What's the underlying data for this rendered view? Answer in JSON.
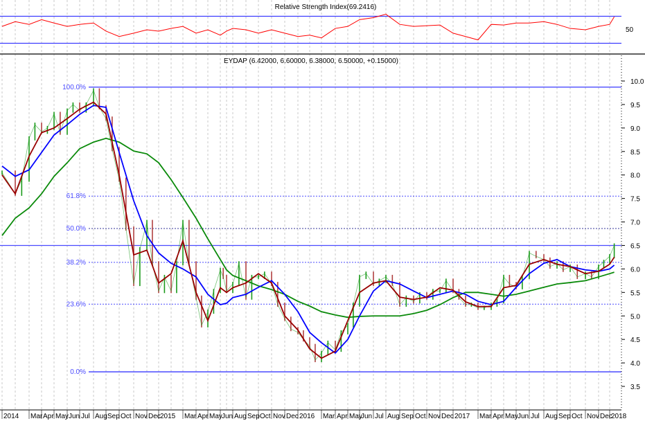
{
  "chart_data": [
    {
      "type": "line",
      "panel": "rsi",
      "title": "Relative Strength Index(69.2416)",
      "y_tick_labels": [
        "50"
      ],
      "guide_levels": [
        70,
        30
      ],
      "ylim": [
        10,
        90
      ],
      "colors": {
        "rsi": "#ff0000",
        "guides": "#3b3bff"
      },
      "series": [
        {
          "x": [
            "2014-01-01",
            "2014-02-01",
            "2014-03-01",
            "2014-04-01",
            "2014-05-01",
            "2014-06-01",
            "2014-07-01",
            "2014-08-01",
            "2014-09-01",
            "2014-10-01",
            "2014-11-01",
            "2014-12-01",
            "2015-01-01",
            "2015-02-01",
            "2015-03-01",
            "2015-04-01",
            "2015-05-01",
            "2015-06-01",
            "2015-07-01",
            "2015-08-01",
            "2015-09-01",
            "2015-10-01",
            "2015-11-01",
            "2015-12-01",
            "2016-01-01",
            "2016-02-01",
            "2016-03-01",
            "2016-04-01",
            "2016-05-01",
            "2016-06-01",
            "2016-07-01",
            "2016-08-01",
            "2016-09-01",
            "2016-10-01",
            "2016-11-01",
            "2016-12-01",
            "2017-01-01",
            "2017-02-01",
            "2017-03-01",
            "2017-04-01",
            "2017-05-01",
            "2017-06-01",
            "2017-07-01",
            "2017-08-01",
            "2017-09-01",
            "2017-10-01",
            "2017-11-01",
            "2017-12-01",
            "2018-01-01",
            "2018-01-12"
          ],
          "values": [
            55,
            62,
            58,
            65,
            60,
            55,
            58,
            60,
            48,
            40,
            45,
            50,
            48,
            52,
            55,
            45,
            50,
            42,
            48,
            52,
            50,
            45,
            50,
            45,
            40,
            42,
            38,
            52,
            55,
            65,
            68,
            73,
            58,
            55,
            56,
            57,
            45,
            40,
            35,
            58,
            57,
            60,
            60,
            62,
            58,
            52,
            50,
            55,
            58,
            69.24
          ]
        }
      ]
    },
    {
      "type": "bar",
      "panel": "price",
      "title": "EYDAP (6.42000, 6.60000, 6.38000, 6.50000, +0.15000)",
      "ylim": [
        3.3,
        10.4
      ],
      "y_tick_labels": [
        "3.5",
        "4.0",
        "4.5",
        "5.0",
        "5.5",
        "6.0",
        "6.5",
        "7.0",
        "7.5",
        "8.0",
        "8.5",
        "9.0",
        "9.5",
        "10.0"
      ],
      "x_tick_labels": [
        {
          "label": "2014",
          "date": "2014-01-01"
        },
        {
          "label": "Mar",
          "date": "2014-03-01"
        },
        {
          "label": "Apr",
          "date": "2014-04-01"
        },
        {
          "label": "May",
          "date": "2014-05-01"
        },
        {
          "label": "Jun",
          "date": "2014-06-01"
        },
        {
          "label": "Jul",
          "date": "2014-07-01"
        },
        {
          "label": "Aug",
          "date": "2014-08-01"
        },
        {
          "label": "Sep",
          "date": "2014-09-01"
        },
        {
          "label": "Oct",
          "date": "2014-10-01"
        },
        {
          "label": "Nov",
          "date": "2014-11-01"
        },
        {
          "label": "Dec",
          "date": "2014-12-01"
        },
        {
          "label": "2015",
          "date": "2015-01-01"
        },
        {
          "label": "Mar",
          "date": "2015-03-01"
        },
        {
          "label": "Apr",
          "date": "2015-04-01"
        },
        {
          "label": "May",
          "date": "2015-05-01"
        },
        {
          "label": "Jun",
          "date": "2015-06-01"
        },
        {
          "label": "Aug",
          "date": "2015-08-01"
        },
        {
          "label": "Sep",
          "date": "2015-09-01"
        },
        {
          "label": "Oct",
          "date": "2015-10-01"
        },
        {
          "label": "Nov",
          "date": "2015-11-01"
        },
        {
          "label": "Dec",
          "date": "2015-12-01"
        },
        {
          "label": "2016",
          "date": "2016-01-01"
        },
        {
          "label": "Mar",
          "date": "2016-03-01"
        },
        {
          "label": "Apr",
          "date": "2016-04-01"
        },
        {
          "label": "May",
          "date": "2016-05-01"
        },
        {
          "label": "Jun",
          "date": "2016-06-01"
        },
        {
          "label": "Jul",
          "date": "2016-07-01"
        },
        {
          "label": "Aug",
          "date": "2016-08-01"
        },
        {
          "label": "Sep",
          "date": "2016-09-01"
        },
        {
          "label": "Oct",
          "date": "2016-10-01"
        },
        {
          "label": "Nov",
          "date": "2016-11-01"
        },
        {
          "label": "Dec",
          "date": "2016-12-01"
        },
        {
          "label": "2017",
          "date": "2017-01-01"
        },
        {
          "label": "Mar",
          "date": "2017-03-01"
        },
        {
          "label": "Apr",
          "date": "2017-04-01"
        },
        {
          "label": "May",
          "date": "2017-05-01"
        },
        {
          "label": "Jun",
          "date": "2017-06-01"
        },
        {
          "label": "Jul",
          "date": "2017-07-01"
        },
        {
          "label": "Aug",
          "date": "2017-08-01"
        },
        {
          "label": "Sep",
          "date": "2017-09-01"
        },
        {
          "label": "Oct",
          "date": "2017-10-01"
        },
        {
          "label": "Nov",
          "date": "2017-11-01"
        },
        {
          "label": "Dec",
          "date": "2017-12-01"
        },
        {
          "label": "2018",
          "date": "2018-01-01"
        }
      ],
      "fibonacci_levels": [
        {
          "label": "100.0%",
          "price": 9.87,
          "style": "solid"
        },
        {
          "label": "61.8%",
          "price": 7.55,
          "style": "dotted"
        },
        {
          "label": "50.0%",
          "price": 6.86,
          "style": "dotted"
        },
        {
          "label": "38.2%",
          "price": 6.14,
          "style": "dotted"
        },
        {
          "label": "23.6%",
          "price": 5.25,
          "style": "dotted"
        },
        {
          "label": "0.0%",
          "price": 3.81,
          "style": "solid"
        }
      ],
      "horizontal_line": 6.5,
      "grid": "vertical dashed",
      "colors": {
        "up": "#1a9a1a",
        "down": "#b04040",
        "ma_short": "#990000",
        "ma_mid": "#0000ff",
        "ma_long": "#0a8a0a",
        "fib": "#4a4aff",
        "fib_mid": "#333399"
      },
      "close": [
        [
          "2014-01-01",
          8.05
        ],
        [
          "2014-02-01",
          7.6
        ],
        [
          "2014-02-15",
          7.9
        ],
        [
          "2014-03-01",
          8.78
        ],
        [
          "2014-03-15",
          9.07
        ],
        [
          "2014-04-01",
          8.92
        ],
        [
          "2014-04-15",
          9.0
        ],
        [
          "2014-05-01",
          9.3
        ],
        [
          "2014-05-15",
          8.9
        ],
        [
          "2014-06-01",
          9.37
        ],
        [
          "2014-06-15",
          9.5
        ],
        [
          "2014-07-01",
          9.37
        ],
        [
          "2014-07-15",
          9.5
        ],
        [
          "2014-08-01",
          9.8
        ],
        [
          "2014-08-15",
          9.44
        ],
        [
          "2014-09-01",
          9.2
        ],
        [
          "2014-09-15",
          8.55
        ],
        [
          "2014-10-01",
          7.9
        ],
        [
          "2014-10-15",
          6.86
        ],
        [
          "2014-11-01",
          5.68
        ],
        [
          "2014-11-15",
          6.42
        ],
        [
          "2014-12-01",
          7.0
        ],
        [
          "2014-12-15",
          6.12
        ],
        [
          "2015-01-01",
          5.53
        ],
        [
          "2015-01-15",
          5.83
        ],
        [
          "2015-02-01",
          5.53
        ],
        [
          "2015-02-15",
          6.12
        ],
        [
          "2015-03-01",
          7.0
        ],
        [
          "2015-03-15",
          6.12
        ],
        [
          "2015-04-01",
          5.39
        ],
        [
          "2015-04-15",
          4.8
        ],
        [
          "2015-05-01",
          5.09
        ],
        [
          "2015-05-15",
          5.53
        ],
        [
          "2015-06-01",
          5.98
        ],
        [
          "2015-06-15",
          5.83
        ],
        [
          "2015-07-01",
          5.53
        ],
        [
          "2015-08-01",
          5.68
        ],
        [
          "2015-08-15",
          6.12
        ],
        [
          "2015-09-01",
          5.39
        ],
        [
          "2015-09-15",
          5.83
        ],
        [
          "2015-10-01",
          5.83
        ],
        [
          "2015-10-15",
          5.9
        ],
        [
          "2015-11-01",
          5.68
        ],
        [
          "2015-11-15",
          5.24
        ],
        [
          "2015-12-01",
          4.94
        ],
        [
          "2015-12-15",
          4.72
        ],
        [
          "2016-01-01",
          4.65
        ],
        [
          "2016-01-15",
          4.5
        ],
        [
          "2016-02-01",
          4.36
        ],
        [
          "2016-02-15",
          4.06
        ],
        [
          "2016-03-01",
          4.21
        ],
        [
          "2016-03-15",
          4.43
        ],
        [
          "2016-04-01",
          4.28
        ],
        [
          "2016-04-15",
          4.65
        ],
        [
          "2016-05-01",
          4.8
        ],
        [
          "2016-05-15",
          5.24
        ],
        [
          "2016-06-01",
          5.83
        ],
        [
          "2016-06-15",
          5.9
        ],
        [
          "2016-07-01",
          5.68
        ],
        [
          "2016-07-15",
          5.75
        ],
        [
          "2016-08-01",
          5.83
        ],
        [
          "2016-08-15",
          5.68
        ],
        [
          "2016-09-01",
          5.24
        ],
        [
          "2016-09-15",
          5.39
        ],
        [
          "2016-10-01",
          5.31
        ],
        [
          "2016-10-15",
          5.46
        ],
        [
          "2016-11-01",
          5.39
        ],
        [
          "2016-11-15",
          5.53
        ],
        [
          "2016-12-01",
          5.53
        ],
        [
          "2016-12-15",
          5.75
        ],
        [
          "2017-01-01",
          5.53
        ],
        [
          "2017-01-15",
          5.39
        ],
        [
          "2017-02-01",
          5.24
        ],
        [
          "2017-02-15",
          5.24
        ],
        [
          "2017-03-01",
          5.17
        ],
        [
          "2017-03-15",
          5.17
        ],
        [
          "2017-04-01",
          5.24
        ],
        [
          "2017-04-15",
          5.31
        ],
        [
          "2017-05-01",
          5.83
        ],
        [
          "2017-05-15",
          5.68
        ],
        [
          "2017-06-01",
          5.61
        ],
        [
          "2017-06-15",
          5.83
        ],
        [
          "2017-07-01",
          6.34
        ],
        [
          "2017-07-15",
          6.27
        ],
        [
          "2017-08-01",
          6.2
        ],
        [
          "2017-08-15",
          6.05
        ],
        [
          "2017-09-01",
          6.12
        ],
        [
          "2017-09-15",
          5.98
        ],
        [
          "2017-10-01",
          6.05
        ],
        [
          "2017-10-15",
          5.83
        ],
        [
          "2017-11-01",
          5.9
        ],
        [
          "2017-11-15",
          5.83
        ],
        [
          "2017-12-01",
          6.05
        ],
        [
          "2017-12-15",
          6.15
        ],
        [
          "2018-01-01",
          6.27
        ],
        [
          "2018-01-12",
          6.5
        ]
      ],
      "moving_averages": {
        "dates": [
          "2014-01-01",
          "2014-02-01",
          "2014-03-01",
          "2014-04-01",
          "2014-05-01",
          "2014-06-01",
          "2014-07-01",
          "2014-08-01",
          "2014-09-01",
          "2014-10-01",
          "2014-11-01",
          "2014-12-01",
          "2015-01-01",
          "2015-02-01",
          "2015-03-01",
          "2015-04-01",
          "2015-05-01",
          "2015-06-01",
          "2015-07-01",
          "2015-08-01",
          "2015-09-01",
          "2015-10-01",
          "2015-11-01",
          "2015-12-01",
          "2016-01-01",
          "2016-02-01",
          "2016-03-01",
          "2016-04-01",
          "2016-05-01",
          "2016-06-01",
          "2016-07-01",
          "2016-08-01",
          "2016-09-01",
          "2016-10-01",
          "2016-11-01",
          "2016-12-01",
          "2017-01-01",
          "2017-02-01",
          "2017-03-01",
          "2017-04-01",
          "2017-05-01",
          "2017-06-01",
          "2017-07-01",
          "2017-08-01",
          "2017-09-01",
          "2017-10-01",
          "2017-11-01",
          "2017-12-01",
          "2018-01-01",
          "2018-01-12"
        ],
        "short": [
          8.0,
          7.6,
          8.4,
          8.9,
          9.0,
          9.2,
          9.4,
          9.55,
          9.3,
          8.0,
          6.3,
          6.4,
          5.7,
          5.9,
          6.6,
          5.5,
          4.9,
          5.6,
          5.5,
          5.6,
          5.7,
          5.9,
          5.7,
          5.0,
          4.7,
          4.3,
          4.1,
          4.25,
          4.9,
          5.5,
          5.7,
          5.75,
          5.4,
          5.35,
          5.4,
          5.6,
          5.55,
          5.3,
          5.2,
          5.2,
          5.6,
          5.65,
          6.1,
          6.2,
          6.1,
          6.05,
          5.9,
          5.95,
          6.1,
          6.25
        ],
        "mid": [
          8.19,
          7.97,
          8.11,
          8.48,
          8.85,
          9.07,
          9.29,
          9.48,
          9.44,
          8.48,
          7.45,
          6.71,
          6.34,
          6.12,
          6.0,
          5.83,
          5.46,
          5.24,
          5.27,
          5.39,
          5.46,
          5.61,
          5.75,
          5.46,
          5.09,
          4.65,
          4.43,
          4.21,
          4.5,
          5.0,
          5.53,
          5.75,
          5.68,
          5.53,
          5.39,
          5.46,
          5.53,
          5.46,
          5.31,
          5.24,
          5.31,
          5.61,
          5.9,
          6.12,
          6.2,
          6.05,
          5.98,
          5.95,
          6.0,
          6.08
        ],
        "long": [
          6.71,
          7.08,
          7.3,
          7.6,
          7.97,
          8.26,
          8.56,
          8.7,
          8.78,
          8.7,
          8.51,
          8.45,
          8.26,
          7.9,
          7.52,
          7.08,
          6.64,
          6.2,
          5.98,
          5.86,
          5.75,
          5.64,
          5.56,
          5.46,
          5.31,
          5.21,
          5.09,
          5.02,
          4.97,
          4.99,
          5.0,
          5.0,
          5.0,
          5.05,
          5.12,
          5.24,
          5.39,
          5.5,
          5.5,
          5.46,
          5.42,
          5.46,
          5.53,
          5.61,
          5.68,
          5.71,
          5.75,
          5.83,
          5.9,
          5.93
        ]
      }
    }
  ]
}
